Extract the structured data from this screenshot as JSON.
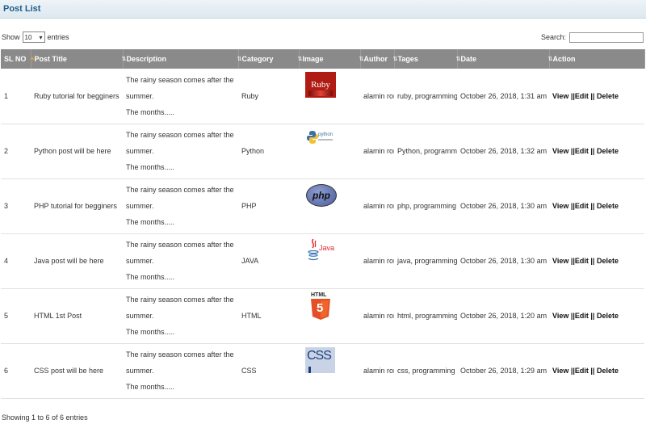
{
  "header": {
    "title": "Post List"
  },
  "controls": {
    "show_label": "Show",
    "page_size": "10",
    "entries_label": "entries",
    "search_label": "Search:",
    "search_value": ""
  },
  "table": {
    "columns": [
      "SL NO",
      "Post Title",
      "Description",
      "Category",
      "Image",
      "Author",
      "Tages",
      "Date",
      "Action"
    ],
    "rows": [
      {
        "sl": "1",
        "title": "Ruby tutorial for begginers",
        "desc1": "The rainy season comes after the summer.",
        "desc2": "The months.....",
        "category": "Ruby",
        "image": "ruby-logo-icon",
        "author": "alamin rony",
        "tags": "ruby, programming",
        "date": "October 26, 2018, 1:31 am"
      },
      {
        "sl": "2",
        "title": "Python post will be here",
        "desc1": "The rainy season comes after the summer.",
        "desc2": "The months.....",
        "category": "Python",
        "image": "python-logo-icon",
        "author": "alamin rony",
        "tags": "Python, programming",
        "date": "October 26, 2018, 1:32 am"
      },
      {
        "sl": "3",
        "title": "PHP tutorial for begginers",
        "desc1": "The rainy season comes after the summer.",
        "desc2": "The months.....",
        "category": "PHP",
        "image": "php-logo-icon",
        "author": "alamin rony",
        "tags": "php, programming",
        "date": "October 26, 2018, 1:30 am"
      },
      {
        "sl": "4",
        "title": "Java post will be here",
        "desc1": "The rainy season comes after the summer.",
        "desc2": "The months.....",
        "category": "JAVA",
        "image": "java-logo-icon",
        "author": "alamin rony",
        "tags": "java, programming",
        "date": "October 26, 2018, 1:30 am"
      },
      {
        "sl": "5",
        "title": "HTML 1st Post",
        "desc1": "The rainy season comes after the summer.",
        "desc2": "The months.....",
        "category": "HTML",
        "image": "html5-logo-icon",
        "author": "alamin rony",
        "tags": "html, programming",
        "date": "October 26, 2018, 1:20 am"
      },
      {
        "sl": "6",
        "title": "CSS post will be here",
        "desc1": "The rainy season comes after the summer.",
        "desc2": "The months.....",
        "category": "CSS",
        "image": "css-logo-icon",
        "author": "alamin rony",
        "tags": "css, programming",
        "date": "October 26, 2018, 1:29 am"
      }
    ]
  },
  "actions": {
    "view": "View",
    "sep1": " ||",
    "edit": "Edit",
    "sep2": " || ",
    "delete": "Delete"
  },
  "logos": {
    "ruby": "Ruby",
    "python": "python",
    "php": "php",
    "java": "Java",
    "html": "HTML",
    "html_num": "5",
    "css": "CSS"
  },
  "footer": {
    "info": "Showing 1 to 6 of 6 entries"
  }
}
